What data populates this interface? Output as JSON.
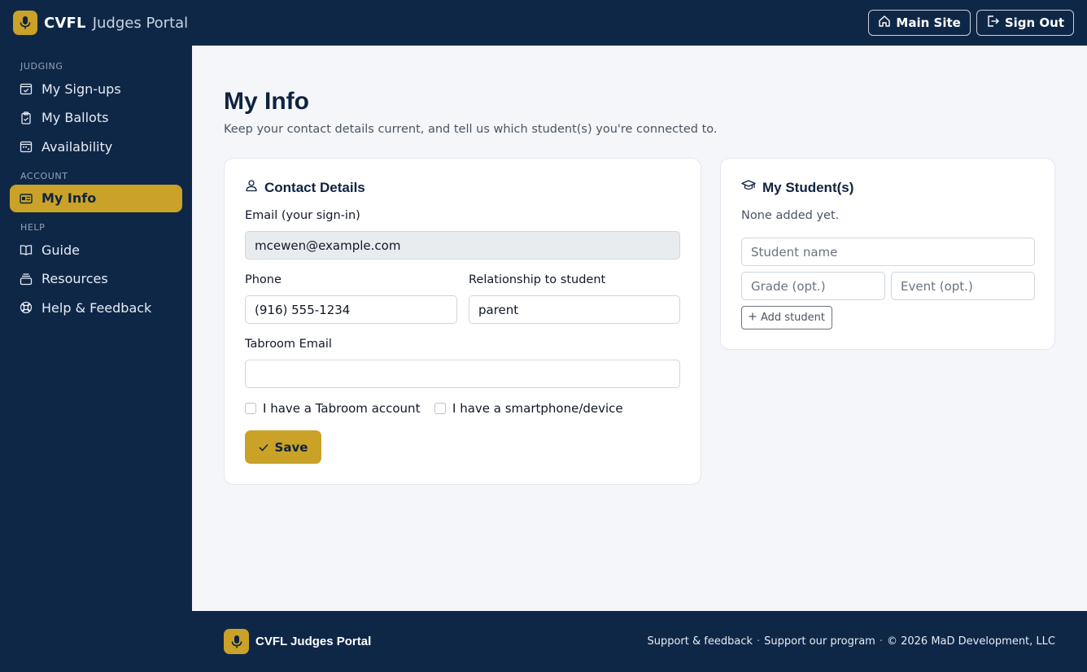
{
  "header": {
    "brand_name": "CVFL",
    "brand_sub": "Judges Portal",
    "main_site_label": "Main Site",
    "sign_out_label": "Sign Out"
  },
  "sidebar": {
    "sections": [
      {
        "title": "JUDGING",
        "items": [
          {
            "label": "My Sign-ups",
            "icon": "calendar-check-icon"
          },
          {
            "label": "My Ballots",
            "icon": "clipboard-icon"
          },
          {
            "label": "Availability",
            "icon": "calendar-week-icon"
          }
        ]
      },
      {
        "title": "ACCOUNT",
        "items": [
          {
            "label": "My Info",
            "icon": "id-card-icon",
            "active": true
          }
        ]
      },
      {
        "title": "HELP",
        "items": [
          {
            "label": "Guide",
            "icon": "book-icon"
          },
          {
            "label": "Resources",
            "icon": "stack-icon"
          },
          {
            "label": "Help & Feedback",
            "icon": "lifebuoy-icon"
          }
        ]
      }
    ]
  },
  "page": {
    "title": "My Info",
    "subtitle": "Keep your contact details current, and tell us which student(s) you're connected to."
  },
  "contact": {
    "heading": "Contact Details",
    "email_label": "Email (your sign-in)",
    "email_value": "mcewen@example.com",
    "phone_label": "Phone",
    "phone_value": "(916) 555-1234",
    "relationship_label": "Relationship to student",
    "relationship_value": "parent",
    "tabroom_label": "Tabroom Email",
    "tabroom_value": "",
    "tabroom_account_label": "I have a Tabroom account",
    "device_label": "I have a smartphone/device",
    "save_label": "Save"
  },
  "students": {
    "heading": "My Student(s)",
    "empty_text": "None added yet.",
    "name_placeholder": "Student name",
    "grade_placeholder": "Grade (opt.)",
    "event_placeholder": "Event (opt.)",
    "add_label": "Add student"
  },
  "footer": {
    "name": "CVFL Judges Portal",
    "link_support": "Support & feedback",
    "link_program": "Support our program",
    "copyright": "© 2026 MaD Development, LLC"
  },
  "colors": {
    "navy": "#0f2747",
    "gold": "#c9a227",
    "background": "#f4f6f9"
  }
}
